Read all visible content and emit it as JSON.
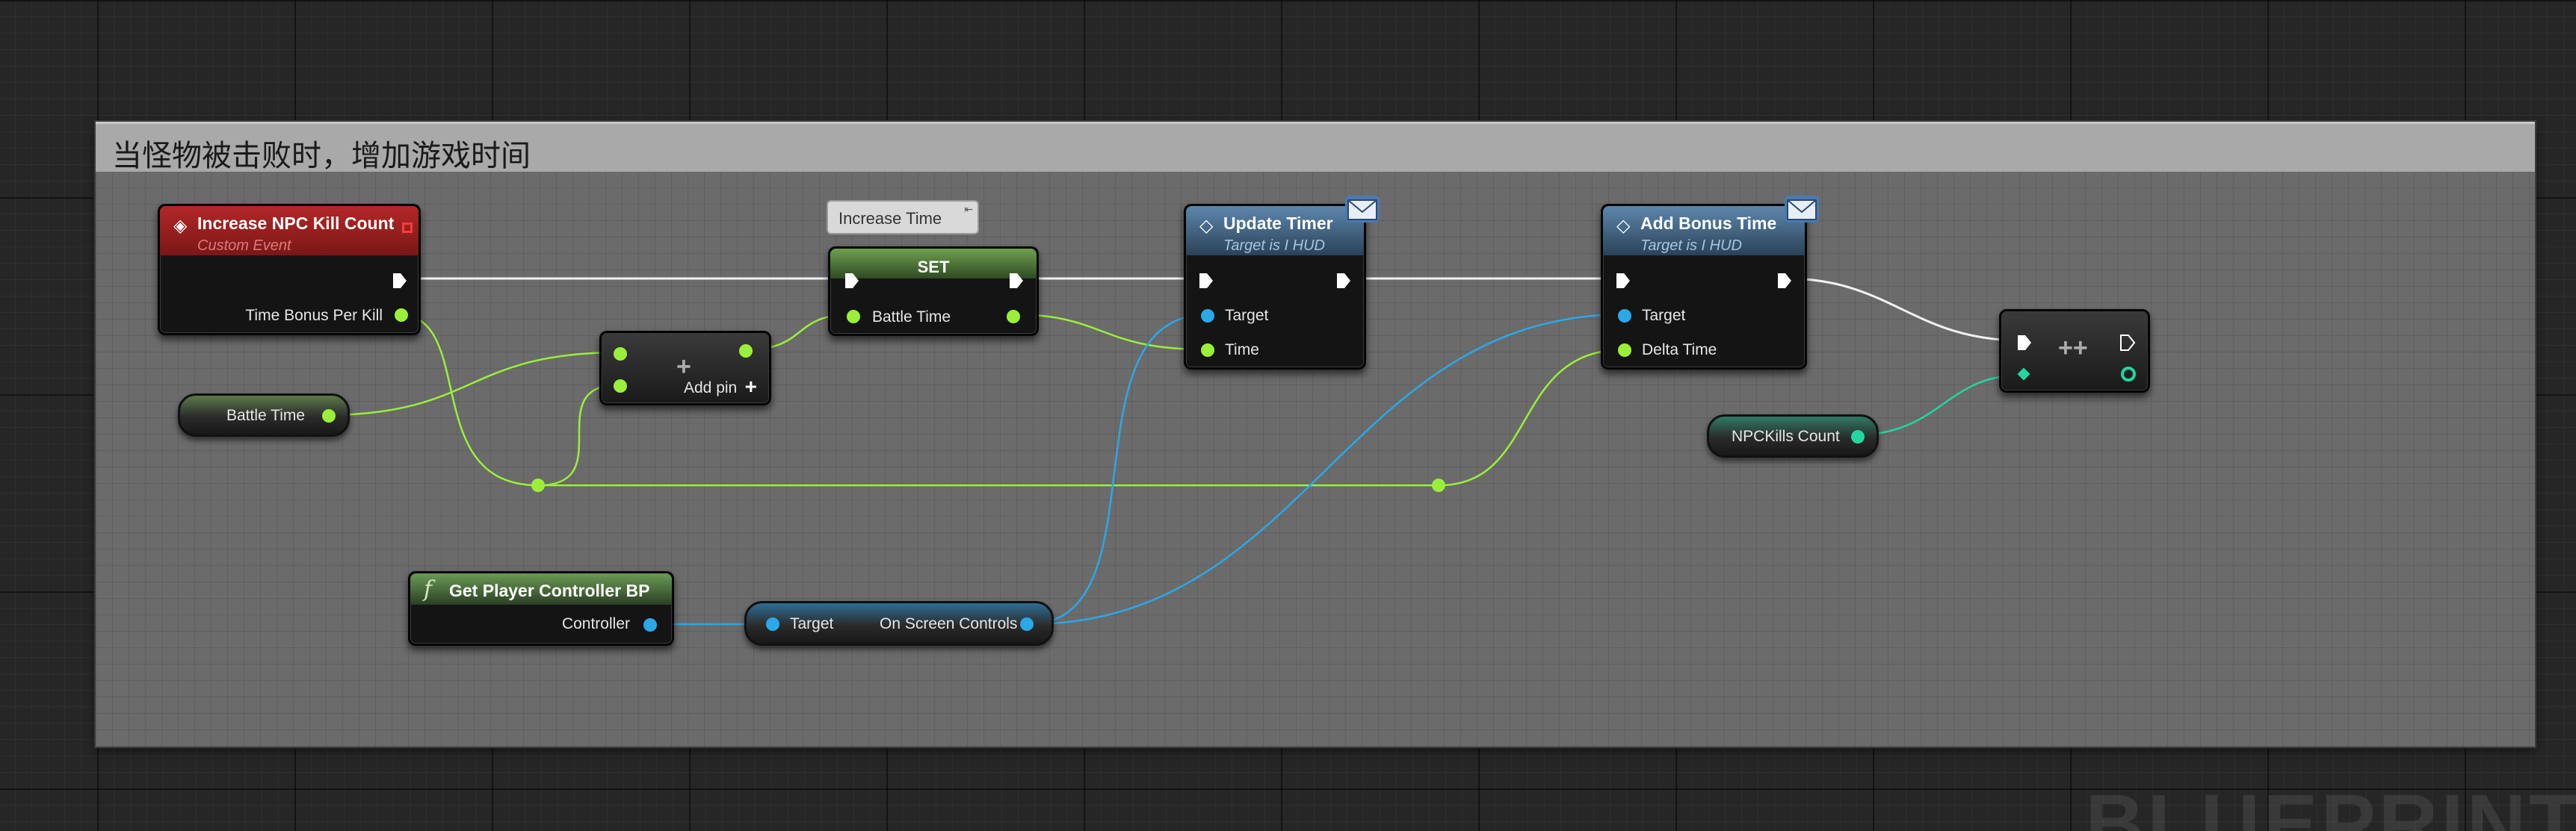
{
  "comment": {
    "title": "当怪物被击败时，增加游戏时间"
  },
  "nodes": {
    "increase_npc_kill_count": {
      "title": "Increase NPC Kill Count",
      "subtitle": "Custom Event",
      "pin_time_bonus": "Time Bonus Per Kill"
    },
    "battle_time_getter": {
      "label": "Battle Time"
    },
    "add_node": {
      "add_pin_label": "Add pin",
      "symbol": "+"
    },
    "set_node": {
      "title": "SET",
      "pin_battle_time": "Battle Time",
      "tooltip": "Increase Time"
    },
    "update_timer": {
      "title": "Update Timer",
      "subtitle": "Target is I HUD",
      "pin_target": "Target",
      "pin_time": "Time"
    },
    "add_bonus_time": {
      "title": "Add Bonus Time",
      "subtitle": "Target is I HUD",
      "pin_target": "Target",
      "pin_delta": "Delta Time"
    },
    "increment_node": {
      "symbol": "++"
    },
    "npc_kills_getter": {
      "label": "NPCKills Count"
    },
    "get_player_controller": {
      "title": "Get Player Controller BP",
      "pin_controller": "Controller"
    },
    "on_screen_controls": {
      "pin_target": "Target",
      "pin_output": "On Screen Controls"
    }
  },
  "watermark": "BLUEPRINT",
  "colors": {
    "float_pin": "#9bef3a",
    "object_pin": "#2aa8e8",
    "int_pin": "#22d6a0",
    "event_header": "#8a1c1c",
    "function_header": "#3e6f95",
    "pure_header": "#4e7a3a"
  },
  "icons": {
    "event": "diamond-event-icon",
    "function": "function-f-icon",
    "message": "envelope-icon",
    "exec": "exec-arrow-icon"
  }
}
